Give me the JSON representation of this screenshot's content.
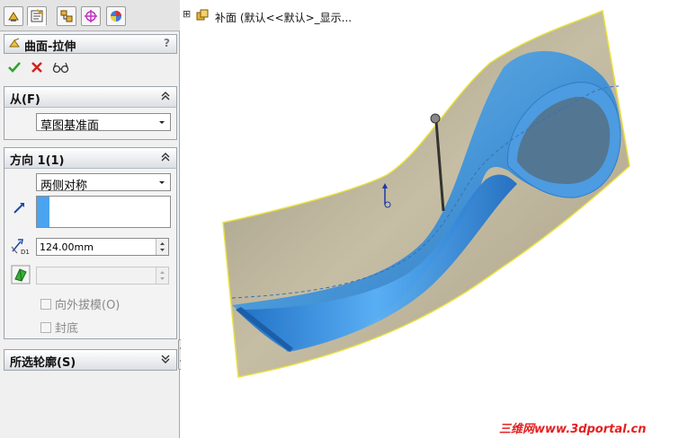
{
  "feature": {
    "title": "曲面-拉伸",
    "help": "?"
  },
  "tree": {
    "expander": "⊞",
    "label": "补面 (默认<<默认>_显示..."
  },
  "from_section": {
    "title": "从(F)",
    "dropdown_value": "草图基准面"
  },
  "direction_section": {
    "title": "方向 1(1)",
    "dropdown_value": "两侧对称",
    "depth_value": "124.00mm",
    "draft_label": "向外拔模(O)",
    "cap_label": "封底"
  },
  "contours_section": {
    "title": "所选轮廓(S)"
  },
  "watermark": "三维网www.3dportal.cn",
  "colors": {
    "surface_blue": "#3a9be8",
    "plane_tan": "#bdb39a",
    "ok_green": "#2aa52a",
    "cancel_red": "#d42020",
    "watermark_red": "#e52020"
  },
  "icons": [
    "feature-manager-tab-icon",
    "property-manager-tab-icon",
    "configuration-manager-tab-icon",
    "dimxpert-tab-icon",
    "display-manager-tab-icon",
    "extrude-feature-icon",
    "ok-check-icon",
    "cancel-x-icon",
    "preview-glasses-icon",
    "reverse-direction-icon",
    "depth-icon",
    "draft-icon"
  ]
}
